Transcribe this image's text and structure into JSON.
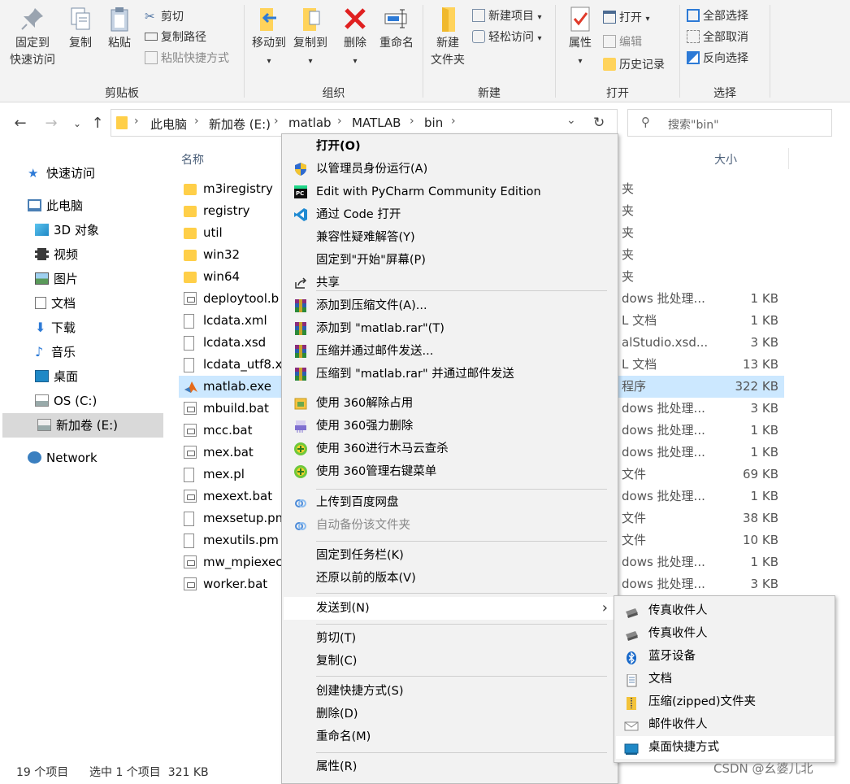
{
  "ribbon": {
    "clipboard": {
      "title": "剪贴板",
      "pin_line1": "固定到",
      "pin_line2": "快速访问",
      "copy": "复制",
      "paste": "粘贴",
      "cut": "剪切",
      "copy_path": "复制路径",
      "paste_shortcut": "粘贴快捷方式"
    },
    "organize": {
      "title": "组织",
      "move_to": "移动到",
      "copy_to": "复制到",
      "delete": "删除",
      "rename": "重命名"
    },
    "new": {
      "title": "新建",
      "new_folder_line1": "新建",
      "new_folder_line2": "文件夹",
      "new_item": "新建项目",
      "easy_access": "轻松访问"
    },
    "open": {
      "title": "打开",
      "properties": "属性",
      "open": "打开",
      "edit": "编辑",
      "history": "历史记录"
    },
    "select": {
      "title": "选择",
      "select_all": "全部选择",
      "select_none": "全部取消",
      "invert": "反向选择"
    }
  },
  "address": {
    "crumbs": [
      "此电脑",
      "新加卷 (E:)",
      "matlab",
      "MATLAB",
      "bin"
    ],
    "search_placeholder": "搜索\"bin\""
  },
  "nav": {
    "items": [
      {
        "label": "快速访问",
        "icon": "star-icon"
      },
      {
        "label": "此电脑",
        "icon": "computer-icon"
      },
      {
        "label": "3D 对象",
        "icon": "cube-icon"
      },
      {
        "label": "视频",
        "icon": "video-icon"
      },
      {
        "label": "图片",
        "icon": "picture-icon"
      },
      {
        "label": "文档",
        "icon": "document-icon"
      },
      {
        "label": "下载",
        "icon": "download-icon"
      },
      {
        "label": "音乐",
        "icon": "music-icon"
      },
      {
        "label": "桌面",
        "icon": "desktop-icon"
      },
      {
        "label": "OS (C:)",
        "icon": "drive-icon"
      },
      {
        "label": "新加卷 (E:)",
        "icon": "drive-icon"
      },
      {
        "label": "Network",
        "icon": "network-icon"
      }
    ]
  },
  "files": {
    "col_name": "名称",
    "col_size": "大小",
    "rows": [
      {
        "name": "m3iregistry",
        "type": "夹",
        "size": "",
        "icon": "folder"
      },
      {
        "name": "registry",
        "type": "夹",
        "size": "",
        "icon": "folder"
      },
      {
        "name": "util",
        "type": "夹",
        "size": "",
        "icon": "folder"
      },
      {
        "name": "win32",
        "type": "夹",
        "size": "",
        "icon": "folder"
      },
      {
        "name": "win64",
        "type": "夹",
        "size": "",
        "icon": "folder"
      },
      {
        "name": "deploytool.b",
        "type": "dows 批处理...",
        "size": "1 KB",
        "icon": "bat"
      },
      {
        "name": "lcdata.xml",
        "type": "L 文档",
        "size": "1 KB",
        "icon": "doc"
      },
      {
        "name": "lcdata.xsd",
        "type": "alStudio.xsd...",
        "size": "3 KB",
        "icon": "doc"
      },
      {
        "name": "lcdata_utf8.xı",
        "type": "L 文档",
        "size": "13 KB",
        "icon": "doc"
      },
      {
        "name": "matlab.exe",
        "type": "程序",
        "size": "322 KB",
        "icon": "matlab"
      },
      {
        "name": "mbuild.bat",
        "type": "dows 批处理...",
        "size": "3 KB",
        "icon": "bat"
      },
      {
        "name": "mcc.bat",
        "type": "dows 批处理...",
        "size": "1 KB",
        "icon": "bat"
      },
      {
        "name": "mex.bat",
        "type": "dows 批处理...",
        "size": "1 KB",
        "icon": "bat"
      },
      {
        "name": "mex.pl",
        "type": "文件",
        "size": "69 KB",
        "icon": "doc"
      },
      {
        "name": "mexext.bat",
        "type": "dows 批处理...",
        "size": "1 KB",
        "icon": "bat"
      },
      {
        "name": "mexsetup.pm",
        "type": "文件",
        "size": "38 KB",
        "icon": "doc"
      },
      {
        "name": "mexutils.pm",
        "type": "文件",
        "size": "10 KB",
        "icon": "doc"
      },
      {
        "name": "mw_mpiexec",
        "type": "dows 批处理...",
        "size": "1 KB",
        "icon": "bat"
      },
      {
        "name": "worker.bat",
        "type": "dows 批处理...",
        "size": "3 KB",
        "icon": "bat"
      }
    ]
  },
  "status": {
    "count": "19 个项目",
    "selected": "选中 1 个项目  321 KB"
  },
  "context_menu": {
    "items": [
      {
        "label": "打开(O)",
        "icon": "",
        "bold": true
      },
      {
        "label": "以管理员身份运行(A)",
        "icon": "shield-icon"
      },
      {
        "label": "Edit with PyCharm Community Edition",
        "icon": "pycharm-icon"
      },
      {
        "label": "通过 Code 打开",
        "icon": "vscode-icon"
      },
      {
        "label": "兼容性疑难解答(Y)",
        "icon": ""
      },
      {
        "label": "固定到\"开始\"屏幕(P)",
        "icon": ""
      },
      {
        "label": "共享",
        "icon": "share-icon"
      },
      {
        "label": "添加到压缩文件(A)...",
        "icon": "winrar-icon"
      },
      {
        "label": "添加到 \"matlab.rar\"(T)",
        "icon": "winrar-icon"
      },
      {
        "label": "压缩并通过邮件发送...",
        "icon": "winrar-icon"
      },
      {
        "label": "压缩到 \"matlab.rar\" 并通过邮件发送",
        "icon": "winrar-icon"
      },
      {
        "label": "使用 360解除占用",
        "icon": "unlock-360-icon"
      },
      {
        "label": "使用 360强力删除",
        "icon": "shred-360-icon"
      },
      {
        "label": "使用 360进行木马云查杀",
        "icon": "scan-360-icon"
      },
      {
        "label": "使用 360管理右键菜单",
        "icon": "menu-360-icon"
      },
      {
        "label": "上传到百度网盘",
        "icon": "baidu-icon"
      },
      {
        "label": "自动备份该文件夹",
        "icon": "baidu-icon",
        "gray": true
      },
      {
        "label": "固定到任务栏(K)",
        "icon": ""
      },
      {
        "label": "还原以前的版本(V)",
        "icon": ""
      },
      {
        "label": "发送到(N)",
        "icon": "",
        "submenu": true
      },
      {
        "label": "剪切(T)",
        "icon": ""
      },
      {
        "label": "复制(C)",
        "icon": ""
      },
      {
        "label": "创建快捷方式(S)",
        "icon": ""
      },
      {
        "label": "删除(D)",
        "icon": ""
      },
      {
        "label": "重命名(M)",
        "icon": ""
      },
      {
        "label": "属性(R)",
        "icon": ""
      }
    ]
  },
  "send_to": {
    "items": [
      {
        "label": "传真收件人",
        "icon": "fax-icon"
      },
      {
        "label": "传真收件人",
        "icon": "fax-icon"
      },
      {
        "label": "蓝牙设备",
        "icon": "bluetooth-icon"
      },
      {
        "label": "文档",
        "icon": "document-icon"
      },
      {
        "label": "压缩(zipped)文件夹",
        "icon": "zip-folder-icon"
      },
      {
        "label": "邮件收件人",
        "icon": "mail-icon"
      },
      {
        "label": "桌面快捷方式",
        "icon": "desktop-icon"
      }
    ]
  },
  "watermark": "CSDN @幺婆儿北"
}
